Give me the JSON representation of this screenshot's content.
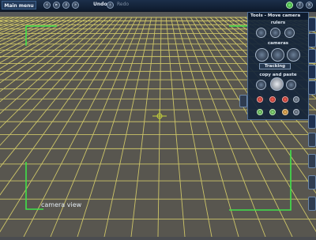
{
  "toolbar": {
    "main_menu_label": "Main menu",
    "undo_label": "Undo",
    "redo_label": "Redo"
  },
  "viewport": {
    "camera_view_label": "camera view",
    "grid_line_color": "#d9d06a",
    "bracket_color": "#3fe24a"
  },
  "tools_panel": {
    "title": "Tools - Move camera",
    "rulers_label": "rulers",
    "cameras_label": "cameras",
    "tracking_label": "Tracking",
    "copy_paste_label": "copy and paste"
  }
}
